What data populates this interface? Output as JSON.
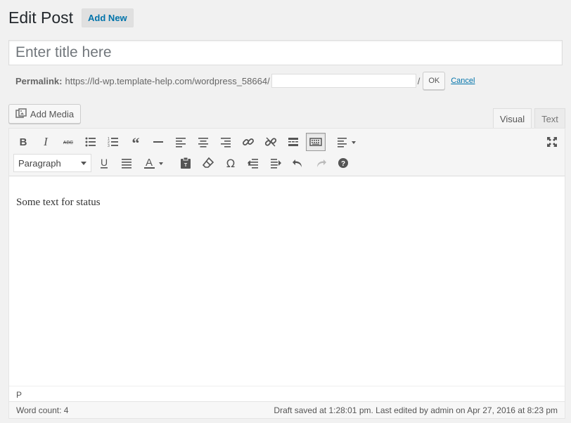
{
  "header": {
    "title": "Edit Post",
    "add_new_label": "Add New"
  },
  "title_field": {
    "placeholder": "Enter title here",
    "value": ""
  },
  "permalink": {
    "label": "Permalink:",
    "base_url": "https://ld-wp.template-help.com/wordpress_58664/",
    "slug_value": "",
    "suffix": "/",
    "ok_label": "OK",
    "cancel_label": "Cancel"
  },
  "media": {
    "add_media_label": "Add Media"
  },
  "tabs": {
    "visual": "Visual",
    "text": "Text"
  },
  "toolbar": {
    "row1": [
      "bold-icon",
      "italic-icon",
      "strikethrough-icon",
      "bullet-list-icon",
      "numbered-list-icon",
      "blockquote-icon",
      "horizontal-line-icon",
      "align-left-icon",
      "align-center-icon",
      "align-right-icon",
      "link-icon",
      "unlink-icon",
      "read-more-icon",
      "toolbar-toggle-icon",
      "text-align-dropdown-icon",
      "fullscreen-icon"
    ],
    "row2": [
      "underline-icon",
      "justify-icon",
      "text-color-icon",
      "paste-text-icon",
      "clear-formatting-icon",
      "special-character-icon",
      "outdent-icon",
      "indent-icon",
      "undo-icon",
      "redo-icon",
      "help-icon"
    ],
    "format_selected": "Paragraph"
  },
  "content": {
    "text": "Some text for status"
  },
  "path_bar": {
    "path": "P"
  },
  "status": {
    "word_count": "Word count: 4",
    "saved": "Draft saved at 1:28:01 pm. Last edited by admin on Apr 27, 2016 at 8:23 pm"
  },
  "colors": {
    "accent": "#0073aa",
    "background": "#f1f1f1",
    "toolbar": "#f5f5f5"
  }
}
